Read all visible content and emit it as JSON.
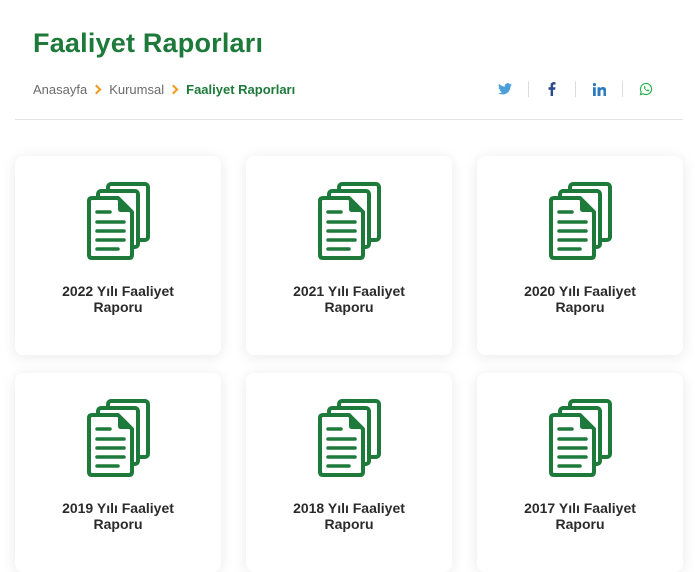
{
  "page": {
    "title": "Faaliyet Raporları"
  },
  "breadcrumb": [
    {
      "label": "Anasayfa"
    },
    {
      "label": "Kurumsal"
    },
    {
      "label": "Faaliyet Raporları"
    }
  ],
  "share": [
    {
      "icon": "twitter-icon",
      "color": "#4a9fd8"
    },
    {
      "icon": "facebook-icon",
      "color": "#2b4a8c"
    },
    {
      "icon": "linkedin-icon",
      "color": "#2a7bbf"
    },
    {
      "icon": "whatsapp-icon",
      "color": "#28b34a"
    }
  ],
  "colors": {
    "brand": "#1d7a3a",
    "accent": "#f19a1a"
  },
  "reports": [
    {
      "title": "2022 Yılı Faaliyet Raporu"
    },
    {
      "title": "2021 Yılı Faaliyet Raporu"
    },
    {
      "title": "2020 Yılı Faaliyet Raporu"
    },
    {
      "title": "2019 Yılı Faaliyet Raporu"
    },
    {
      "title": "2018 Yılı Faaliyet Raporu"
    },
    {
      "title": "2017 Yılı Faaliyet Raporu"
    }
  ]
}
